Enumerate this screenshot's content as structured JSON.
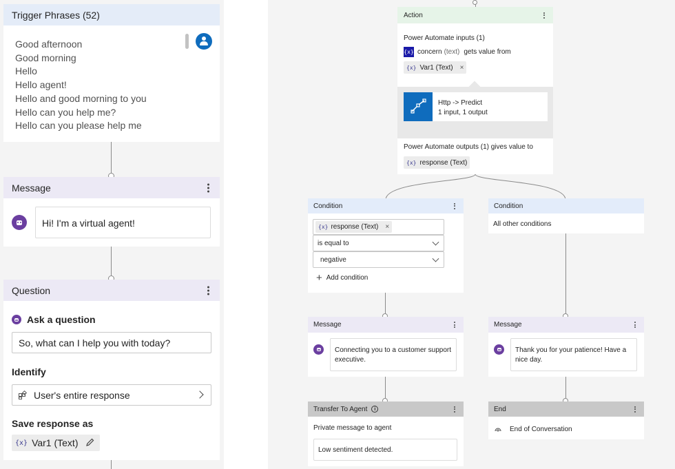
{
  "trigger": {
    "title": "Trigger Phrases (52)",
    "phrases": [
      "Good afternoon",
      "Good morning",
      "Hello",
      "Hello agent!",
      "Hello and good morning to you",
      "Hello can you help me?",
      "Hello can you please help me"
    ]
  },
  "message1": {
    "title": "Message",
    "text": "Hi! I'm a virtual agent!"
  },
  "question": {
    "title": "Question",
    "ask_label": "Ask a question",
    "ask_text": "So, what can I help you with today?",
    "identify_label": "Identify",
    "identify_value": "User's entire response",
    "save_label": "Save response as",
    "var_badge": "{x}",
    "var_name": "Var1 (Text)"
  },
  "action": {
    "title": "Action",
    "inputs_label": "Power Automate inputs (1)",
    "input_var": "concern",
    "input_type": "(text)",
    "gets_value_from": "gets value from",
    "source_var": "Var1 (Text)",
    "flow_title": "Http -> Predict",
    "flow_sub": "1 input, 1 output",
    "outputs_label": "Power Automate outputs (1) gives value to",
    "output_var": "response (Text)"
  },
  "condition1": {
    "title": "Condition",
    "var": "response (Text)",
    "operator": "is equal to",
    "value": "negative",
    "add_label": "Add condition"
  },
  "condition2": {
    "title": "Condition",
    "text": "All other conditions"
  },
  "message2": {
    "title": "Message",
    "text": "Connecting you to a customer support executive."
  },
  "message3": {
    "title": "Message",
    "text": "Thank you for your patience! Have a nice day."
  },
  "transfer": {
    "title": "Transfer To Agent",
    "label": "Private message to agent",
    "text": "Low sentiment detected."
  },
  "end": {
    "title": "End",
    "text": "End of Conversation"
  },
  "colors": {
    "trigger_header": "#e4ecf8",
    "message_header": "#ece9f5",
    "action_header": "#e6f4e8",
    "condition_header": "#e3ecfa",
    "transfer_header": "#c8c8c8",
    "bot": "#6b3fa0",
    "accent": "#0f6cbd"
  }
}
